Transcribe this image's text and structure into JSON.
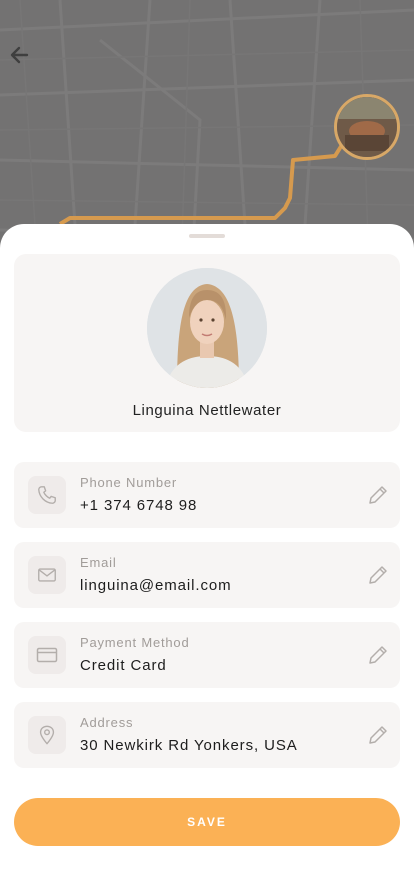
{
  "map": {
    "route_color": "#d69a4e"
  },
  "profile": {
    "name": "Linguina Nettlewater"
  },
  "fields": [
    {
      "label": "Phone Number",
      "value": "+1 374 6748 98",
      "icon": "phone-icon"
    },
    {
      "label": "Email",
      "value": "linguina@email.com",
      "icon": "mail-icon"
    },
    {
      "label": "Payment Method",
      "value": "Credit Card",
      "icon": "credit-card-icon"
    },
    {
      "label": "Address",
      "value": "30 Newkirk Rd Yonkers, USA",
      "icon": "location-pin-icon"
    }
  ],
  "actions": {
    "save_label": "SAVE"
  },
  "colors": {
    "accent": "#fbb155",
    "card_bg": "#f7f5f4"
  }
}
